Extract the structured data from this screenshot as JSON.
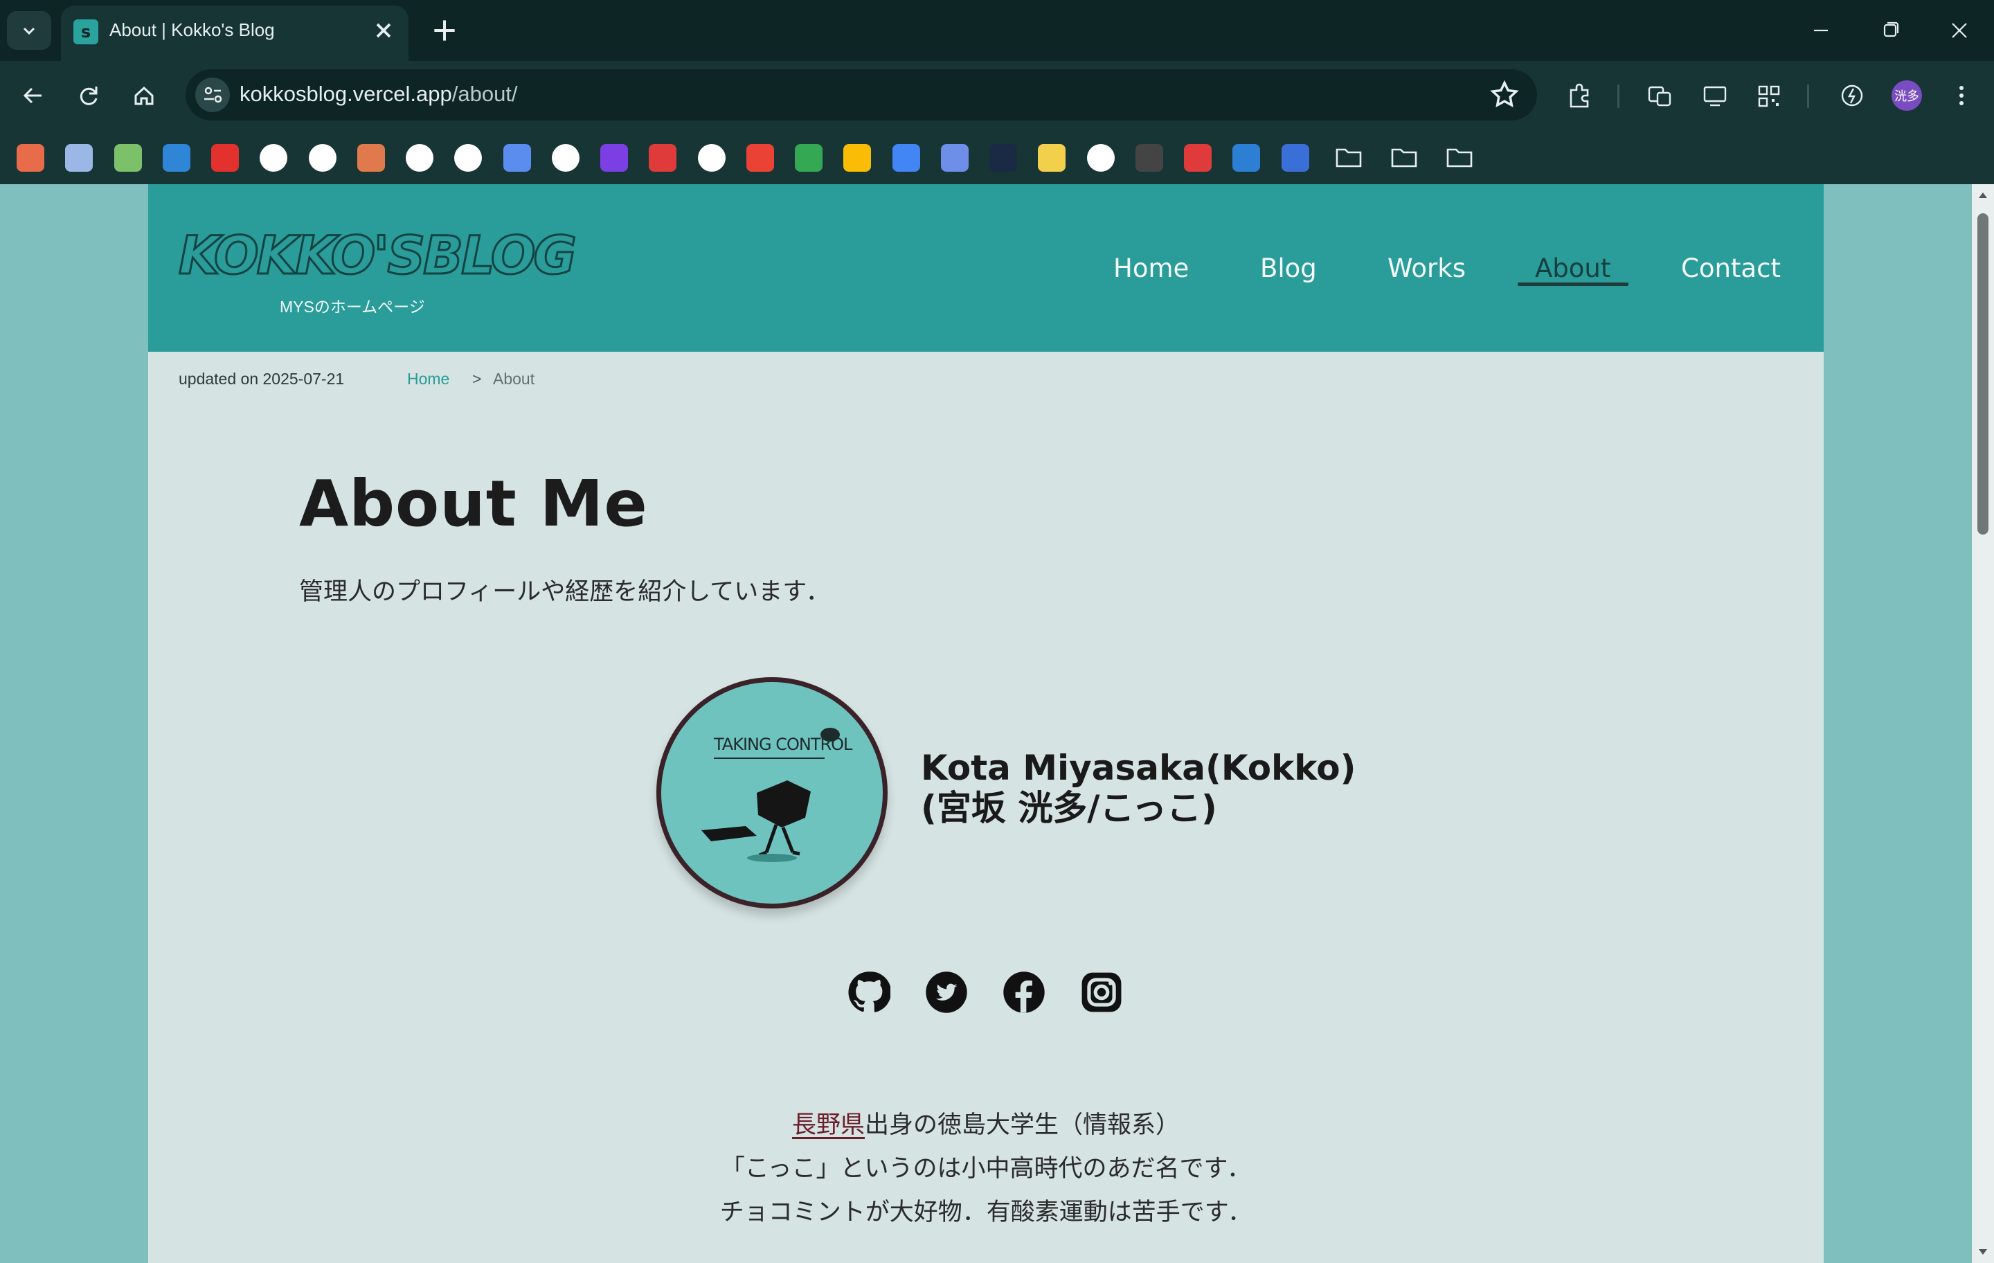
{
  "browser": {
    "tab": {
      "title": "About | Kokko's Blog"
    },
    "url": {
      "host": "kokkosblog.vercel.app",
      "path": "/about/"
    },
    "profile_initials": "洸多",
    "bookmark_icons": [
      "kokko-icon",
      "photo-icon",
      "plant-icon",
      "onedrive-icon",
      "youtube-icon",
      "github-icon",
      "vercel-icon",
      "claude-icon",
      "perplexity-icon",
      "chatgpt-icon",
      "gemini-icon",
      "robot-icon",
      "notion-icon",
      "mask-icon",
      "grammarly-icon",
      "gmail-icon",
      "maps-icon",
      "drive-icon",
      "calendar-icon",
      "translate-icon",
      "terminal-icon",
      "coin-icon",
      "qr-icon",
      "dark-icon",
      "refresh-icon",
      "globe-icon",
      "edge-icon",
      "folder-icon",
      "folder-icon",
      "folder-icon"
    ]
  },
  "site": {
    "logo": "KOKKO'SBLOG",
    "tagline": "MYSのホームページ",
    "nav": [
      "Home",
      "Blog",
      "Works",
      "About",
      "Contact"
    ],
    "active_nav": "About",
    "updated": "updated on 2025-07-21",
    "breadcrumb": {
      "home": "Home",
      "separator": ">",
      "current": "About"
    },
    "title": "About Me",
    "subtitle": "管理人のプロフィールや経歴を紹介しています．",
    "avatar_text": "TAKING CONTROL",
    "name_line1": "Kota Miyasaka(Kokko)",
    "name_line2": "(宮坂 洸多/こっこ)",
    "social": [
      "github-icon",
      "twitter-icon",
      "facebook-icon",
      "instagram-icon"
    ],
    "bio": {
      "prefecture": "長野県",
      "line1_rest": "出身の徳島大学生（情報系）",
      "line2": "「こっこ」というのは小中高時代のあだ名です．",
      "line3": "チョコミントが大好物．有酸素運動は苦手です．"
    },
    "colors": {
      "header": "#2a9c99",
      "body": "#d5e3e3",
      "outer": "#7fc0be",
      "accent": "#2a9c99"
    }
  }
}
